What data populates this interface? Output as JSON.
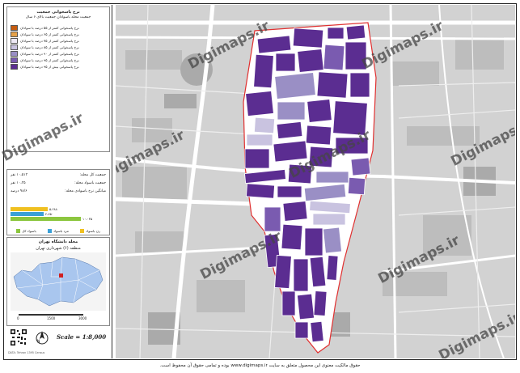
{
  "legend": {
    "title": "نرخ پاسخوانی جمعیت",
    "subtitle": "جمعیت محله باسوادان جمعیت بالای ۶ سال",
    "items": [
      {
        "label": "نرخ پاسخوانی کمتر از ۵۵ درصد با سوادان",
        "color": "#c65c0f"
      },
      {
        "label": "نرخ پاسخوانی کمتر از ۶۵ درصد با سوادان",
        "color": "#e5a24a"
      },
      {
        "label": "نرخ پاسخوانی کمتر از ۷۵ درصد با سوادان",
        "color": "#ede8f5"
      },
      {
        "label": "نرخ پاسخوانی کمتر از ۸۵ درصد با سوادان",
        "color": "#c9c3e0"
      },
      {
        "label": "نرخ پاسخوانی کمتر از ۹۰ درصد با سوادان",
        "color": "#9a8fc5"
      },
      {
        "label": "نرخ پاسخوانی کمتر از ۹۵ درصد با سوادان",
        "color": "#7a5bb0"
      },
      {
        "label": "نرخ پاسخوانی بیش از ۹۵ درصد با سوادان",
        "color": "#5b2d91"
      }
    ]
  },
  "stats": {
    "rows": [
      {
        "label": "جمعیت کل محله:",
        "value": "۱۰،۵۱۳ نفر"
      },
      {
        "label": "جمعیت باسواد محله:",
        "value": "۱۰،۳۵ نفر"
      },
      {
        "label": "میانگین نرخ باسوادی محله:",
        "value": "۹۸/۶ درصد"
      }
    ],
    "bars": [
      {
        "value": "۵،۲۸۸",
        "color": "#f0c020",
        "fraction": 0.46
      },
      {
        "value": "۴،۷۵۰",
        "color": "#3aa0d8",
        "fraction": 0.41
      },
      {
        "value": "۱۰،۰۳۵",
        "color": "#8cc63f",
        "fraction": 0.87
      }
    ],
    "bar_legend": [
      {
        "label": "باسواد کل",
        "color": "#8cc63f"
      },
      {
        "label": "مرد باسواد",
        "color": "#3aa0d8"
      },
      {
        "label": "زن باسواد",
        "color": "#f0c020"
      }
    ]
  },
  "location": {
    "title": "محله دانشگاه تهران",
    "subtitle": "منطقه (۶) شهرداری تهران",
    "scale_ticks": [
      "0",
      "1500",
      "3000"
    ]
  },
  "scale": {
    "text": "Scale = 1:8,000"
  },
  "map": {
    "watermark": "Digimaps.ir",
    "neighborhood_fill": "#ffffff",
    "boundary_color": "#e03030"
  },
  "footer": {
    "text": "حقوق مالکیت معنوی این محصول متعلق به سایت www.digimaps.ir بوده و تمامی حقوق آن محفوظ است."
  },
  "small_print": "DATA: Tehran 1395 Census"
}
